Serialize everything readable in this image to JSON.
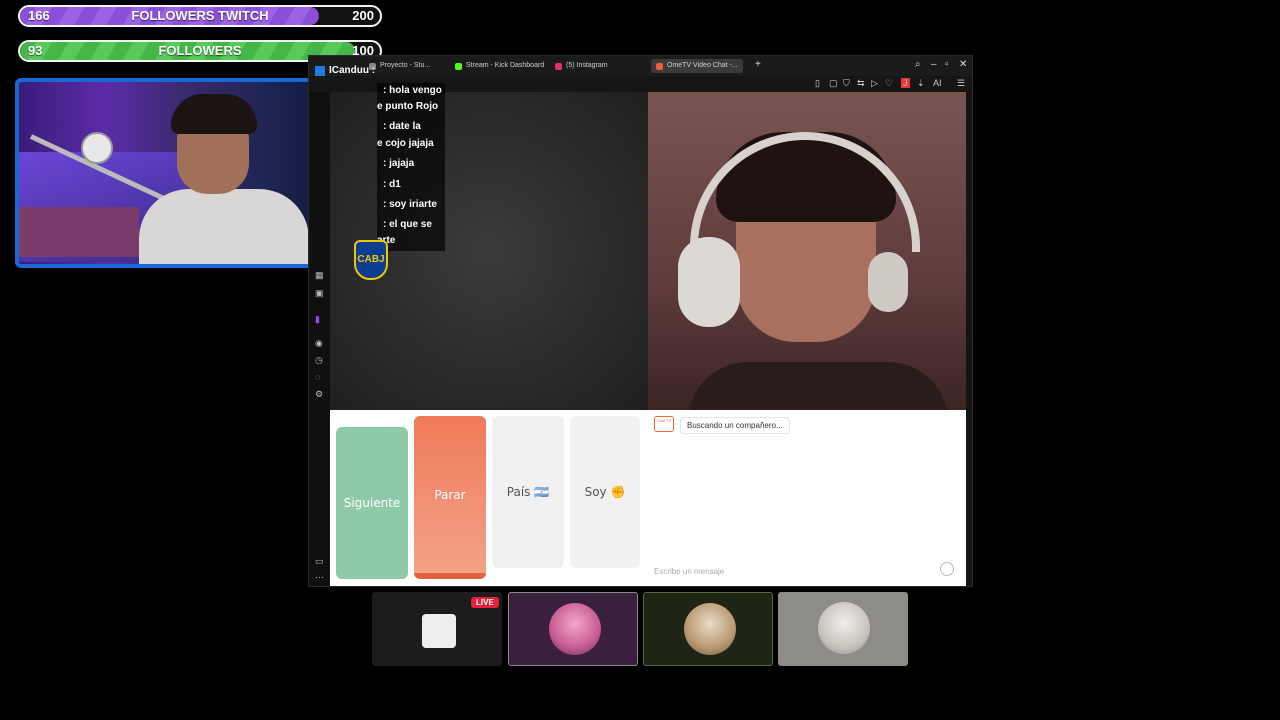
{
  "goals": {
    "twitch": {
      "current": "166",
      "label": "FOLLOWERS TWITCH",
      "target": "200",
      "progress": 0.83
    },
    "kick": {
      "current": "93",
      "label": "FOLLOWERS",
      "target": "100",
      "progress": 0.93
    }
  },
  "chat_overlay": {
    "username": "ICanduu :",
    "messages": [
      ": hola vengo",
      "e punto Rojo",
      ": date la",
      "e cojo jajaja",
      ": jajaja",
      ": d1",
      ": soy iriarte",
      ": el que se",
      "arte"
    ]
  },
  "crest": {
    "text": "CABJ"
  },
  "browser": {
    "tabs": [
      {
        "label": "Proyecto - Stu...",
        "color": "#888888"
      },
      {
        "label": "Stream - Kick Dashboard",
        "color": "#53fc18"
      },
      {
        "label": "(5) Instagram",
        "color": "#e1306c"
      },
      {
        "label": "OmeTV Video Chat -...",
        "color": "#e85d3a"
      }
    ],
    "toolbar_right_label": "AI"
  },
  "ometv": {
    "buttons": {
      "next": "Siguiente",
      "stop": "Parar",
      "country": "País 🇦🇷",
      "gender": "Soy ✊"
    },
    "status_message": "Buscando un compañero...",
    "input_placeholder": "Escribe un mensaje",
    "logo_text": "Ome TV"
  },
  "thumbnails": {
    "live_label": "LIVE"
  }
}
